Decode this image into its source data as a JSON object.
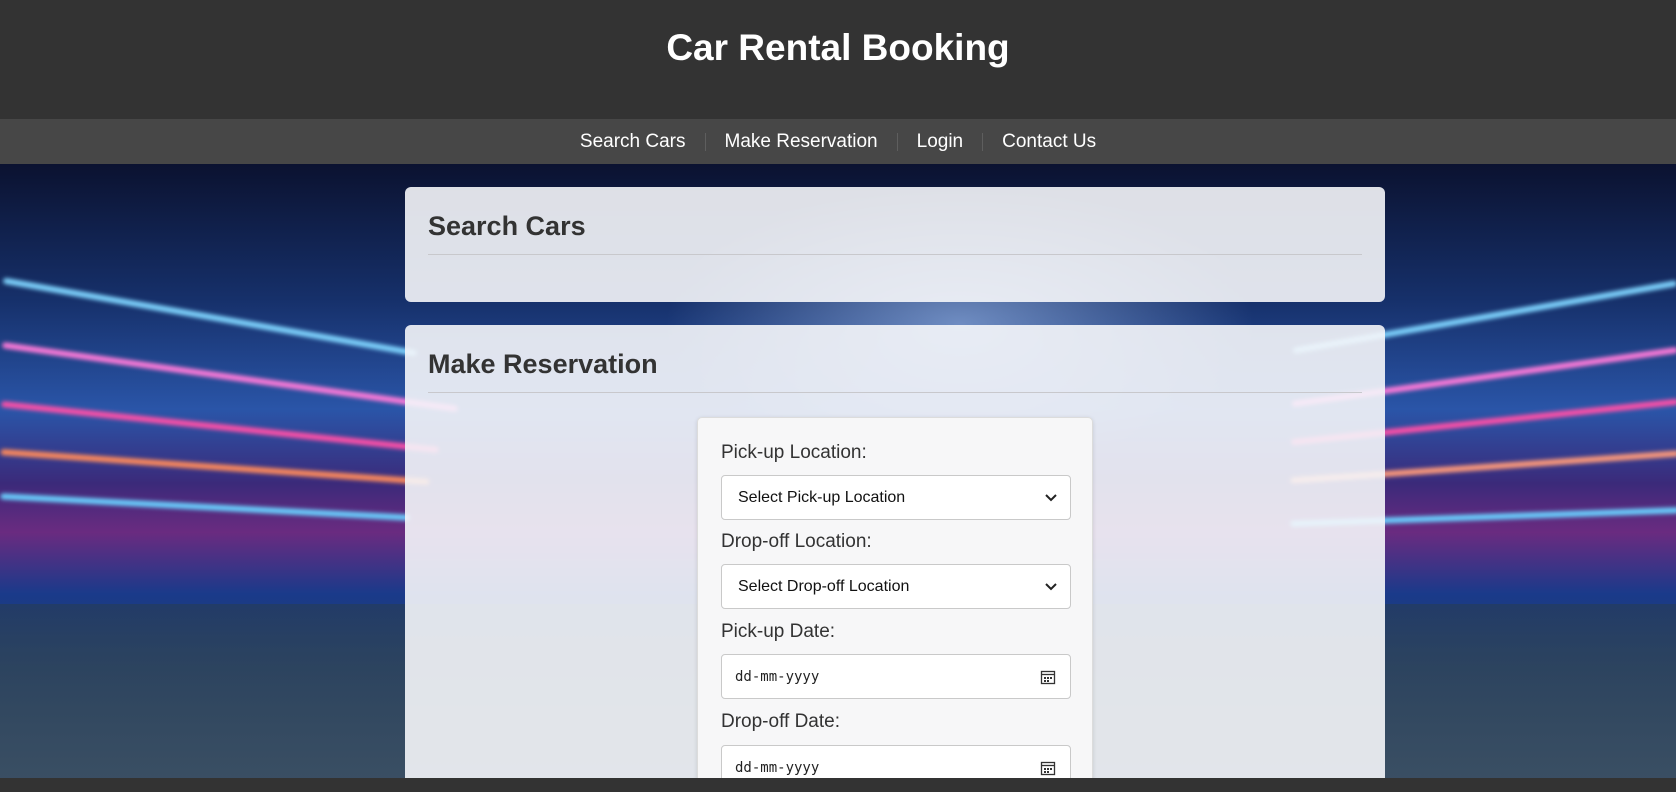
{
  "header": {
    "title": "Car Rental Booking"
  },
  "nav": {
    "items": [
      {
        "label": "Search Cars"
      },
      {
        "label": "Make Reservation"
      },
      {
        "label": "Login"
      },
      {
        "label": "Contact Us"
      }
    ]
  },
  "search_section": {
    "title": "Search Cars"
  },
  "reservation_section": {
    "title": "Make Reservation",
    "form": {
      "pickup_location": {
        "label": "Pick-up Location:",
        "selected": "Select Pick-up Location"
      },
      "dropoff_location": {
        "label": "Drop-off Location:",
        "selected": "Select Drop-off Location"
      },
      "pickup_date": {
        "label": "Pick-up Date:",
        "placeholder": "dd-mm-yyyy"
      },
      "dropoff_date": {
        "label": "Drop-off Date:",
        "placeholder": "dd-mm-yyyy"
      }
    }
  },
  "icons": {
    "select_arrow": "chevron-down-icon",
    "date_picker": "calendar-icon"
  },
  "colors": {
    "header_bg": "#333333",
    "nav_bg": "#474747",
    "text_light": "#ffffff",
    "text_dark": "#333333"
  }
}
